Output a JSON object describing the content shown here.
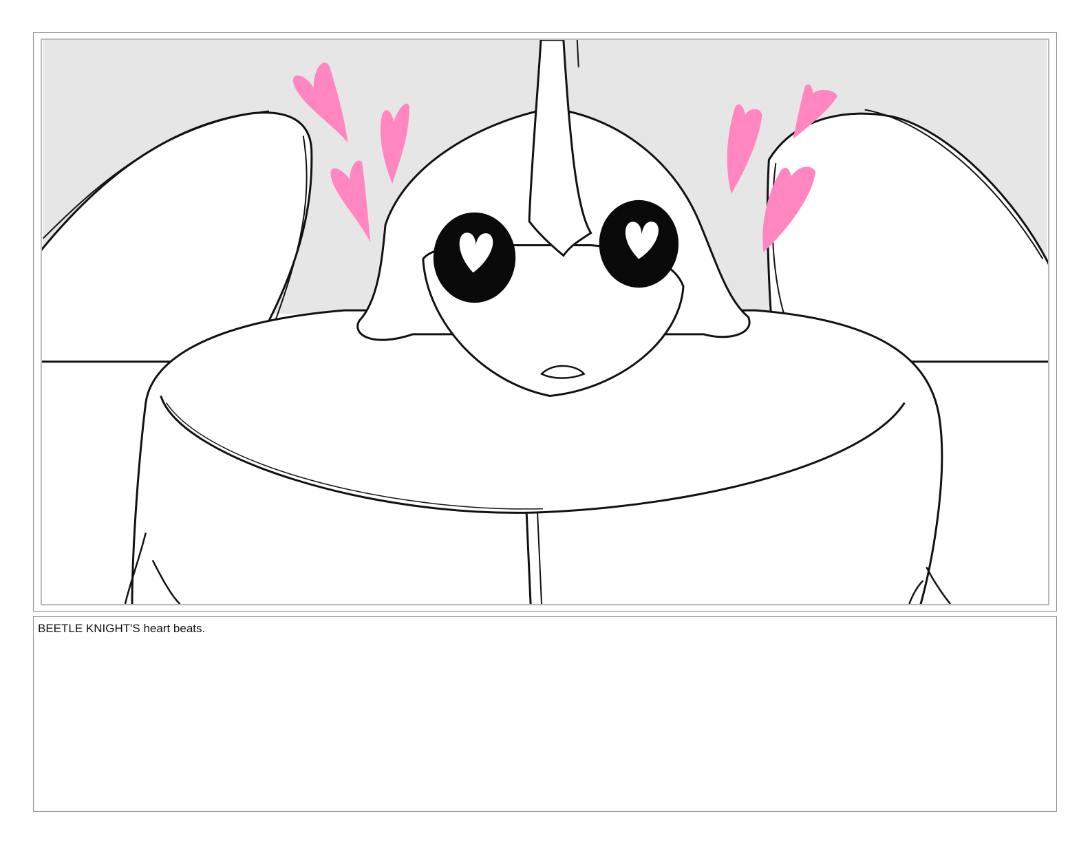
{
  "storyboard": {
    "panel": {
      "image_name": "beetle-knight-sketch",
      "colors": {
        "background_sky": "#e6e6e6",
        "line": "#111111",
        "heart": "#ff86c0",
        "eye": "#0a0a0a",
        "fill": "#ffffff"
      }
    },
    "caption": {
      "text": "BEETLE KNIGHT'S heart beats."
    }
  }
}
